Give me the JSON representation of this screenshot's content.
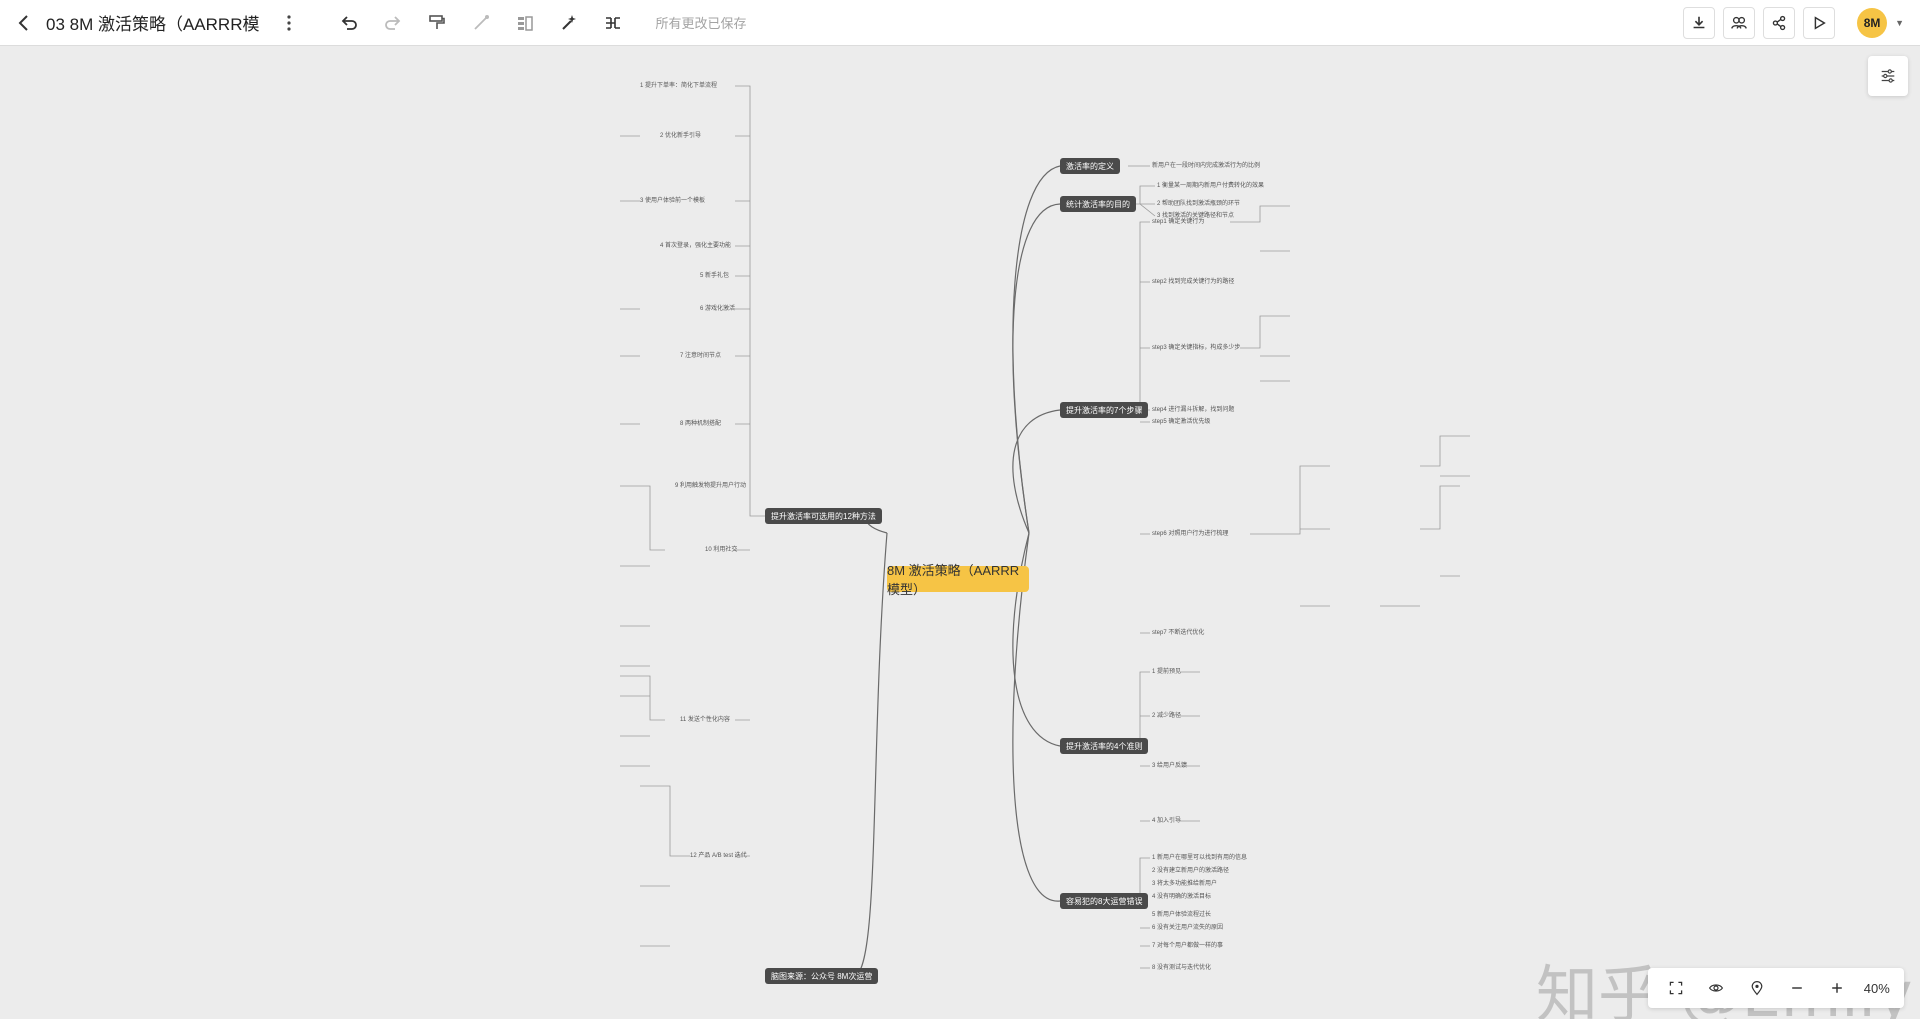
{
  "toolbar": {
    "title": "03 8M 激活策略（AARRR模",
    "saved_status": "所有更改已保存",
    "avatar": "8M"
  },
  "mindmap": {
    "center": "8M 激活策略（AARRR模型）",
    "branches": [
      "激活率的定义",
      "统计激活率的目的",
      "提升激活率的7个步骤",
      "提升激活率可选用的12种方法",
      "提升激活率的4个准则",
      "容易犯的8大运营错误",
      "脑图来源：公众号 8M次运营"
    ],
    "leaves_right": [
      "新用户在一段时间内完成激活行为的比例",
      "1 衡量某一周期内新用户付费转化的效果",
      "2 帮助团队找到激活瓶颈的环节",
      "3 找到激活的关键路径和节点",
      "step1 确定关键行为",
      "step2 找到完成关键行为的路径",
      "step3 确定关键指标，构成多少步",
      "step4 进行漏斗拆解，找到问题",
      "step5 确定激活优先级",
      "step6 对照用户行为进行梳理",
      "step7 不断迭代优化",
      "1 提前预见",
      "2 减少路径",
      "3 给用户反馈",
      "4 加入引导",
      "1 新用户在哪里可以找到有用的信息",
      "2 没有建立新用户的激活路径",
      "3 将太多功能推给新用户",
      "4 没有明确的激活目标",
      "5 新用户体验流程过长",
      "6 没有关注用户流失的原因",
      "7 对每个用户都做一样的事",
      "8 没有测试与迭代优化"
    ],
    "leaves_left": [
      "1 提升下单率：简化下单流程",
      "2 优化新手引导",
      "3 使用户体验前一个模板",
      "4 首次登录，强化主要功能",
      "5 新手礼包",
      "6 游戏化激活",
      "7 注意时间节点",
      "8 两种机制搭配",
      "9 利用触发物提升用户行动",
      "10 利用社交",
      "11 发送个性化内容",
      "12 产品 A/B test 迭代"
    ]
  },
  "zoom": {
    "value": "40%"
  },
  "watermark": "知乎 @Emily"
}
